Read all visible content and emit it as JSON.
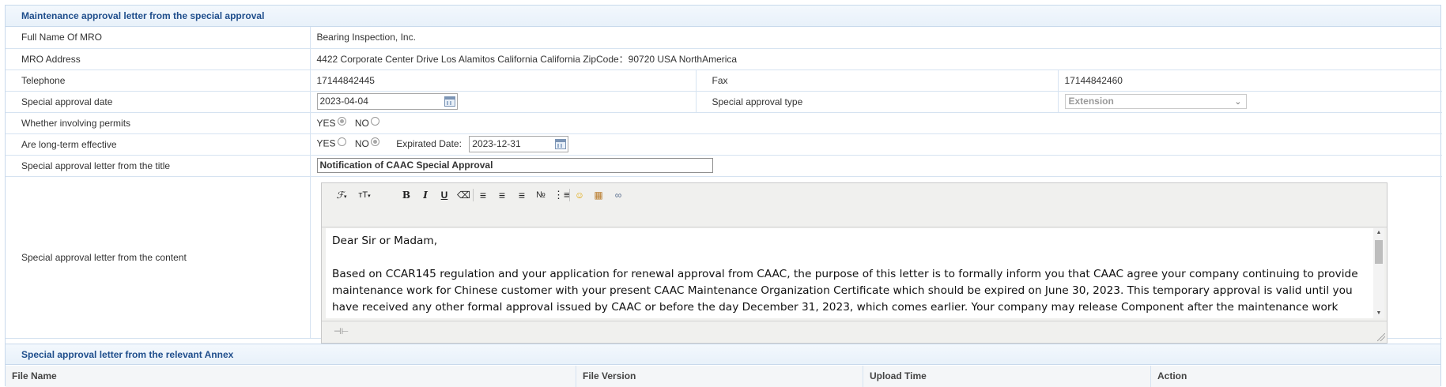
{
  "section_title": "Maintenance approval letter from the special approval",
  "rows": {
    "mro_name": {
      "label": "Full Name Of MRO",
      "value": "Bearing Inspection, Inc."
    },
    "mro_address": {
      "label": "MRO Address",
      "value": "4422 Corporate Center Drive Los Alamitos California California ZipCode：90720 USA NorthAmerica"
    },
    "telephone": {
      "label": "Telephone",
      "value": "17144842445"
    },
    "fax": {
      "label": "Fax",
      "value": "17144842460"
    },
    "approval_date": {
      "label": "Special approval date",
      "value": "2023-04-04"
    },
    "approval_type": {
      "label": "Special approval type",
      "value": "Extension"
    },
    "permits": {
      "label": "Whether involving permits",
      "yes": "YES",
      "no": "NO",
      "selected": "YES"
    },
    "long_term": {
      "label": "Are long-term effective",
      "yes": "YES",
      "no": "NO",
      "selected": "NO",
      "expirated_label": "Expirated Date:",
      "expirated_value": "2023-12-31"
    },
    "letter_title": {
      "label": "Special approval letter from the title",
      "value": "Notification of CAAC Special Approval"
    },
    "letter_content": {
      "label": "Special approval letter from the content"
    }
  },
  "editor": {
    "toolbar_icons": [
      "font-family-icon",
      "font-size-icon",
      "bold-icon",
      "italic-icon",
      "underline-icon",
      "eraser-icon",
      "align-left-icon",
      "align-center-icon",
      "align-right-icon",
      "ordered-list-icon",
      "unordered-list-icon",
      "emoticon-icon",
      "image-icon",
      "link-icon"
    ],
    "content": {
      "greeting": "Dear Sir or Madam,",
      "body": "Based on CCAR145 regulation and your application for renewal approval from CAAC, the purpose of this letter is to formally inform you that CAAC agree your company continuing to provide maintenance work for Chinese customer with your present CAAC Maintenance Organization Certificate which should be expired on June 30, 2023. This temporary approval is valid until you have received any other formal approval issued by CAAC or before the day December 31, 2023, which comes earlier. Your company may release Component after the maintenance work finished during this period by this Special"
    }
  },
  "annex": {
    "title": "Special approval letter from the relevant Annex",
    "columns": [
      "File Name",
      "File Version",
      "Upload Time",
      "Action"
    ]
  }
}
